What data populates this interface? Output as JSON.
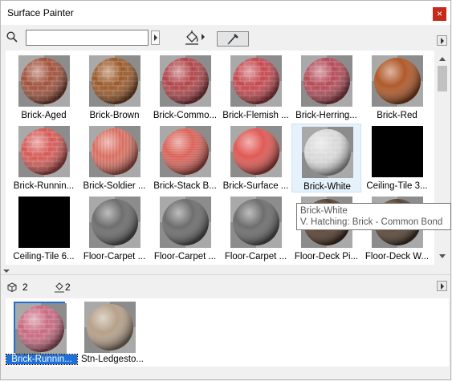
{
  "window": {
    "title": "Surface Painter",
    "close_glyph": "×"
  },
  "toolbar": {
    "search_value": "",
    "search_placeholder": "",
    "search_icon": "search-icon",
    "paint_icon": "paint-bucket-icon",
    "eyedropper_icon": "eyedropper-icon"
  },
  "surfaces": [
    {
      "label": "Brick-Aged",
      "swatch": "#a0523c",
      "pattern": "brick"
    },
    {
      "label": "Brick-Brown",
      "swatch": "#9b5a2a",
      "pattern": "brick"
    },
    {
      "label": "Brick-Commo...",
      "swatch": "#b0454a",
      "pattern": "brick"
    },
    {
      "label": "Brick-Flemish ...",
      "swatch": "#c4484f",
      "pattern": "brick"
    },
    {
      "label": "Brick-Herring...",
      "swatch": "#b44b58",
      "pattern": "herring"
    },
    {
      "label": "Brick-Red",
      "swatch": "#b05a2a",
      "pattern": "none"
    },
    {
      "label": "Brick-Runnin...",
      "swatch": "#d55a56",
      "pattern": "brick"
    },
    {
      "label": "Brick-Soldier ...",
      "swatch": "#d86a5c",
      "pattern": "soldier"
    },
    {
      "label": "Brick-Stack B...",
      "swatch": "#d85f55",
      "pattern": "stack"
    },
    {
      "label": "Brick-Surface ...",
      "swatch": "#e05a55",
      "pattern": "none"
    },
    {
      "label": "Brick-White",
      "swatch": "#d9d9d9",
      "pattern": "brick"
    },
    {
      "label": "Ceiling-Tile 3...",
      "swatch": "#000000",
      "pattern": "black"
    },
    {
      "label": "Ceiling-Tile 6...",
      "swatch": "#000000",
      "pattern": "black"
    },
    {
      "label": "Floor-Carpet ...",
      "swatch": "#6e6e6e",
      "pattern": "none"
    },
    {
      "label": "Floor-Carpet ...",
      "swatch": "#6e6e6e",
      "pattern": "none"
    },
    {
      "label": "Floor-Carpet ...",
      "swatch": "#6e6e6e",
      "pattern": "none"
    },
    {
      "label": "Floor-Deck Pi...",
      "swatch": "#5a4030",
      "pattern": "none"
    },
    {
      "label": "Floor-Deck W...",
      "swatch": "#5a4535",
      "pattern": "none"
    }
  ],
  "selected_index": 10,
  "tooltip": {
    "line1": "Brick-White",
    "line2": "V. Hatching: Brick - Common Bond"
  },
  "stats": {
    "elements_count": "2",
    "painted_count": "2"
  },
  "recent": [
    {
      "label": "Brick-Runnin...",
      "swatch": "#c96a80",
      "selected": true
    },
    {
      "label": "Stn-Ledgesto...",
      "swatch": "#b6a18a",
      "selected": false
    }
  ]
}
